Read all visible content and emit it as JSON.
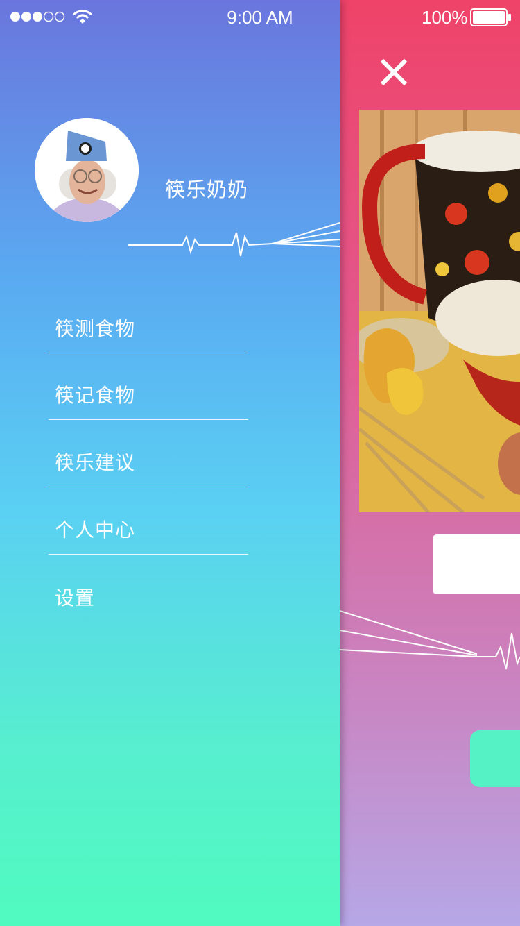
{
  "status_bar": {
    "time": "9:00 AM",
    "battery_percent": "100%",
    "signal_icon": "signal-dots-icon",
    "wifi_icon": "wifi-icon",
    "battery_icon": "battery-icon"
  },
  "profile": {
    "name": "筷乐奶奶",
    "avatar_icon": "avatar"
  },
  "menu": {
    "items": [
      {
        "label": "筷测食物"
      },
      {
        "label": "筷记食物"
      },
      {
        "label": "筷乐建议"
      },
      {
        "label": "个人中心"
      },
      {
        "label": "设置"
      }
    ]
  },
  "main": {
    "close_icon": "close-icon"
  },
  "colors": {
    "drawer_top": "#6a76dd",
    "drawer_bottom": "#50fbbf",
    "main_top": "#ef4369",
    "main_bottom": "#b6a7e6",
    "accent_green": "#55f2c5"
  }
}
